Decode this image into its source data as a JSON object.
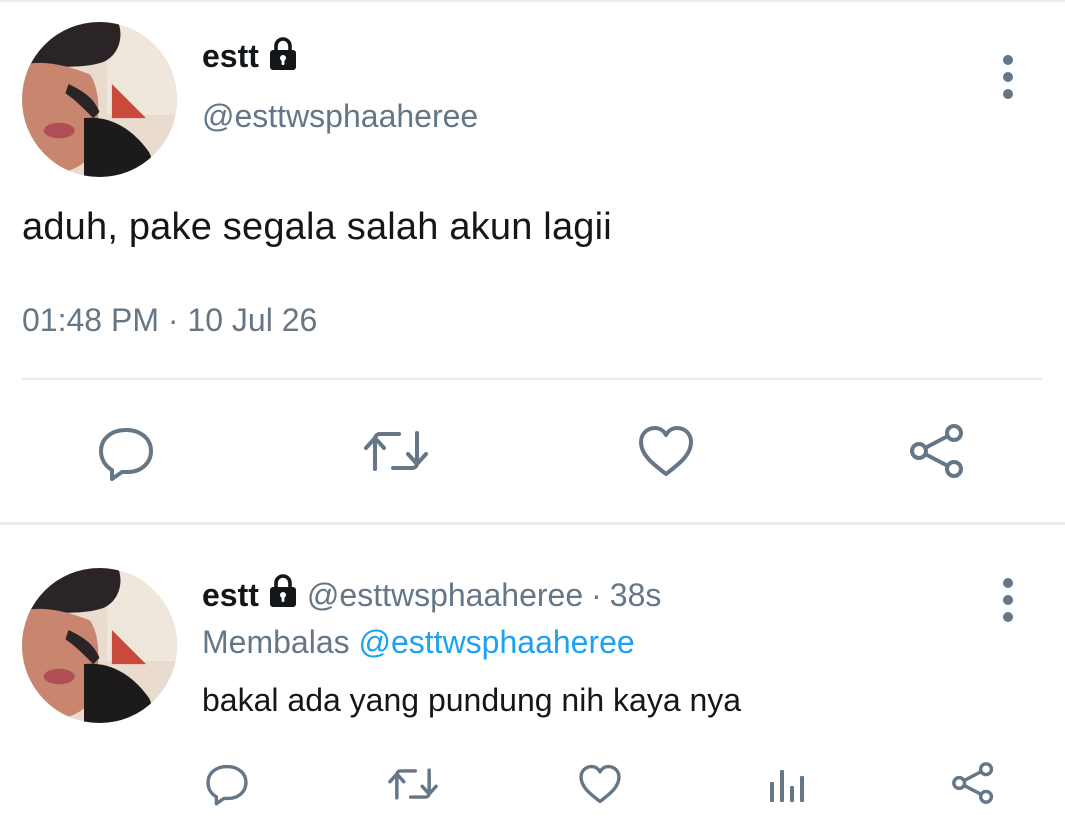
{
  "main_tweet": {
    "display_name": "estt",
    "handle": "@esttwsphaaheree",
    "text": "aduh, pake segala salah akun lagii",
    "time": "01:48 PM",
    "separator": "·",
    "date": "10 Jul 26",
    "icons": [
      "lock-icon",
      "more-vertical-icon",
      "reply-icon",
      "retweet-icon",
      "like-icon",
      "share-icon"
    ]
  },
  "reply_tweet": {
    "display_name": "estt",
    "handle": "@esttwsphaaheree",
    "separator": "·",
    "age": "38s",
    "replying_label": "Membalas",
    "replying_to": "@esttwsphaaheree",
    "text": "bakal ada yang pundung nih kaya nya",
    "icons": [
      "lock-icon",
      "more-vertical-icon",
      "reply-icon",
      "retweet-icon",
      "like-icon",
      "analytics-icon",
      "share-icon"
    ]
  },
  "colors": {
    "text": "#14171a",
    "muted": "#657786",
    "link": "#1da1f2",
    "divider": "#e6ecf0"
  }
}
